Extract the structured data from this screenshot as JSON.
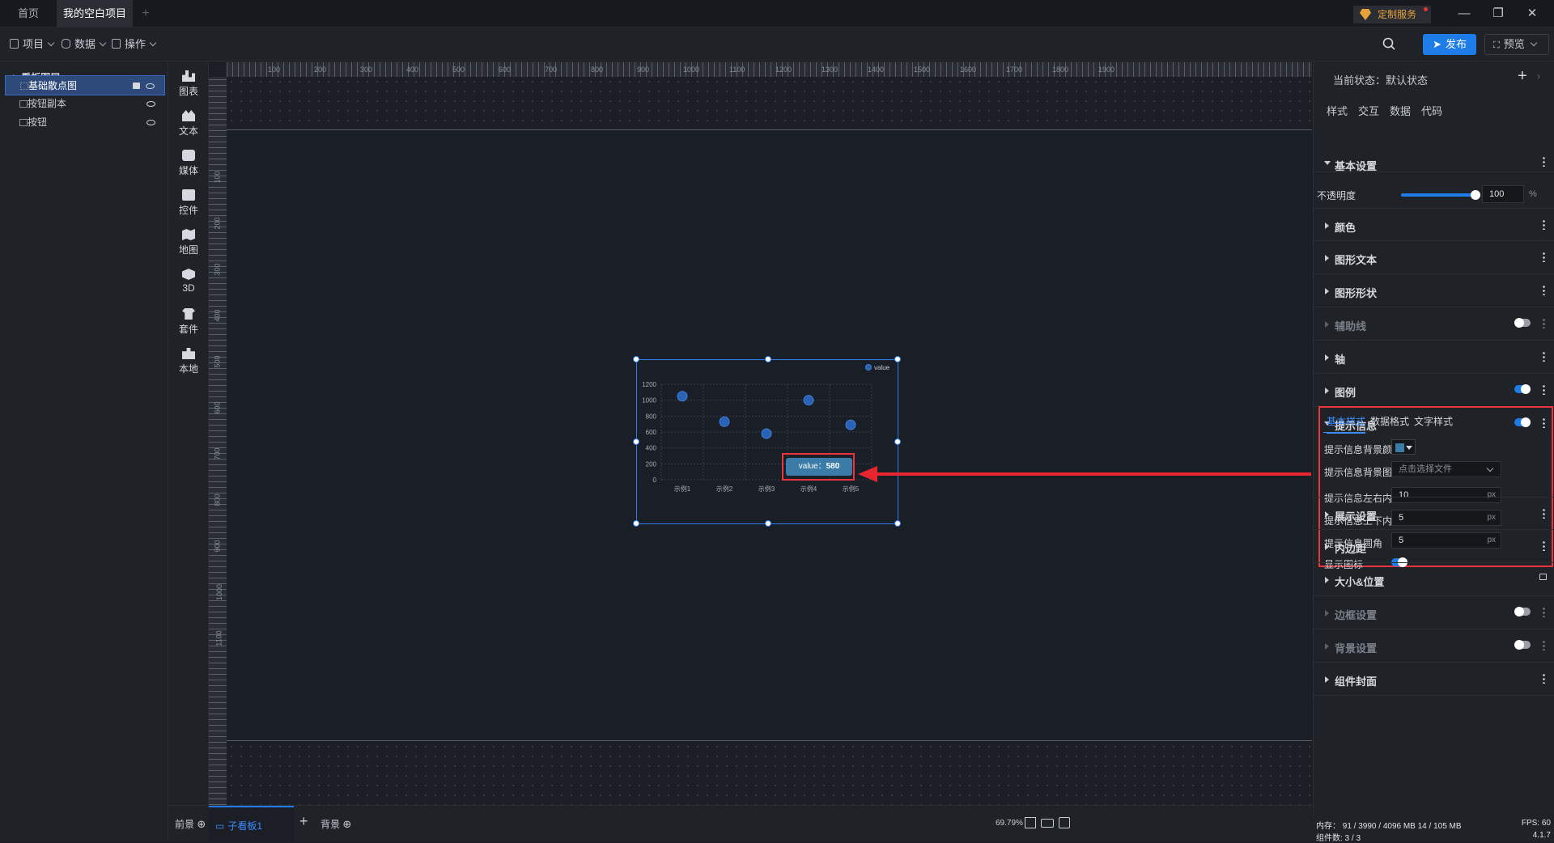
{
  "titlebar": {
    "tabs": [
      {
        "label": "首页",
        "active": false
      },
      {
        "label": "我的空白项目",
        "active": true,
        "unsaved": true
      }
    ],
    "add_tab": "+",
    "custom_service": "定制服务",
    "minimize": "—",
    "restore": "❐",
    "close": "✕"
  },
  "toolbar": {
    "menus": [
      "项目",
      "数据",
      "操作"
    ],
    "publish": "发布",
    "preview": "预览"
  },
  "layers": {
    "title": "看板图层",
    "items": [
      {
        "label": "基础散点图",
        "selected": true
      },
      {
        "label": "按钮副本",
        "selected": false
      },
      {
        "label": "按钮",
        "selected": false
      }
    ]
  },
  "components": [
    "图表",
    "文本",
    "媒体",
    "控件",
    "地图",
    "3D",
    "套件",
    "本地"
  ],
  "rulers": {
    "top": [
      "100",
      "200",
      "300",
      "400",
      "500",
      "600",
      "700",
      "800",
      "900",
      "1000",
      "1100",
      "1200",
      "1300",
      "1400",
      "1500",
      "1600",
      "1700",
      "1800",
      "1900"
    ],
    "left": [
      "100",
      "200",
      "300",
      "400",
      "500",
      "600",
      "700",
      "800",
      "900",
      "1000",
      "1100"
    ]
  },
  "chart_data": {
    "type": "scatter",
    "categories": [
      "示例1",
      "示例2",
      "示例3",
      "示例4",
      "示例5"
    ],
    "series": [
      {
        "name": "value",
        "values": [
          1050,
          730,
          580,
          1000,
          690
        ]
      }
    ],
    "yticks": [
      "0",
      "200",
      "400",
      "600",
      "800",
      "1000",
      "1200"
    ],
    "ylim": [
      0,
      1200
    ],
    "grid": true,
    "legend": "top-right",
    "tooltip": {
      "label": "value：",
      "value": "580"
    },
    "colors": {
      "point": "#2a62b8",
      "tooltip_bg": "#3a7ba8"
    }
  },
  "right_panel": {
    "state_label": "当前状态：默认状态",
    "tabs": [
      "样式",
      "交互",
      "数据",
      "代码"
    ],
    "sections": {
      "basic": "基本设置",
      "opacity_label": "不透明度",
      "opacity_value": "100",
      "opacity_unit": "%",
      "opacity_fraction": 1.0,
      "color": "颜色",
      "shape_text": "图形文本",
      "shape_form": "图形形状",
      "guide": "辅助线",
      "axis": "轴",
      "legend": "图例",
      "tooltip": "提示信息",
      "display": "展示设置",
      "padding": "内边距",
      "size_pos": "大小&位置",
      "border": "边框设置",
      "background": "背景设置",
      "cover": "组件封面"
    },
    "tooltip_settings": {
      "tabs": [
        "基本样式",
        "数据格式",
        "文字样式"
      ],
      "bg_color_label": "提示信息背景颜色",
      "bg_image_label": "提示信息背景图片",
      "bg_image_placeholder": "点击选择文件",
      "pad_lr_label": "提示信息左右内...",
      "pad_lr_value": "10",
      "pad_tb_label": "提示信息上下内...",
      "pad_tb_value": "5",
      "radius_label": "提示信息圆角",
      "radius_value": "5",
      "unit": "px",
      "show_icon_label": "显示图标"
    }
  },
  "bottombar": {
    "tabs": [
      "前景",
      "子看板1",
      "背景"
    ],
    "zoom": "69.79%"
  },
  "status": {
    "memory": "内存：  91 / 3990 / 4096 MB  14 / 105 MB",
    "fps": "FPS:  60",
    "components": "组件数: 3 / 3",
    "version": "4.1.7"
  }
}
